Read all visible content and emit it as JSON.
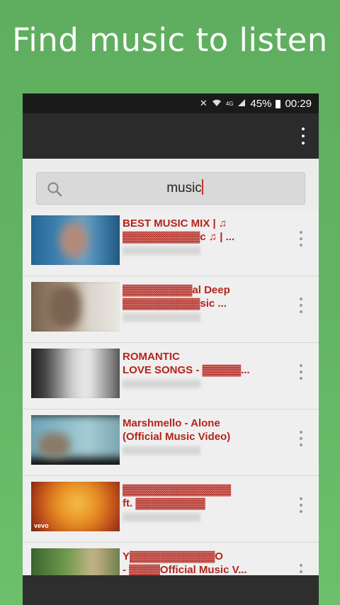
{
  "headline": "Find music to listen",
  "status_bar": {
    "network": "4G",
    "battery": "45%",
    "time": "00:29",
    "icons": [
      "mute-icon",
      "wifi-icon",
      "signal-icon",
      "battery-icon"
    ]
  },
  "app_bar": {
    "menu_icon": "overflow-menu-icon"
  },
  "search": {
    "query": "music",
    "icon": "search-icon"
  },
  "results": [
    {
      "title_line1": "BEST MUSIC MIX | ♫",
      "title_line2": "▓▓▓▓▓▓▓▓▓▓c ♫ | ...",
      "channel": ""
    },
    {
      "title_line1": "▓▓▓▓▓▓▓▓▓al Deep",
      "title_line2": "▓▓▓▓▓▓▓▓▓▓sic ...",
      "channel": ""
    },
    {
      "title_line1": "ROMANTIC",
      "title_line2": "LOVE SONGS - ▓▓▓▓▓...",
      "channel": ""
    },
    {
      "title_line1": "Marshmello - Alone",
      "title_line2": "(Official Music Video)",
      "channel": ""
    },
    {
      "title_line1": "▓▓▓▓▓▓▓▓▓▓▓▓▓▓",
      "title_line2": "ft. ▓▓▓▓▓▓▓▓▓",
      "channel": "",
      "badge": "vevo"
    },
    {
      "title_line1": "Y▓▓▓▓▓▓▓▓▓▓▓O",
      "title_line2": "- ▓▓▓▓Official Music V...",
      "channel": ""
    }
  ],
  "colors": {
    "background": "#62b462",
    "title_red": "#b3241c",
    "appbar": "#2b2b2b"
  }
}
